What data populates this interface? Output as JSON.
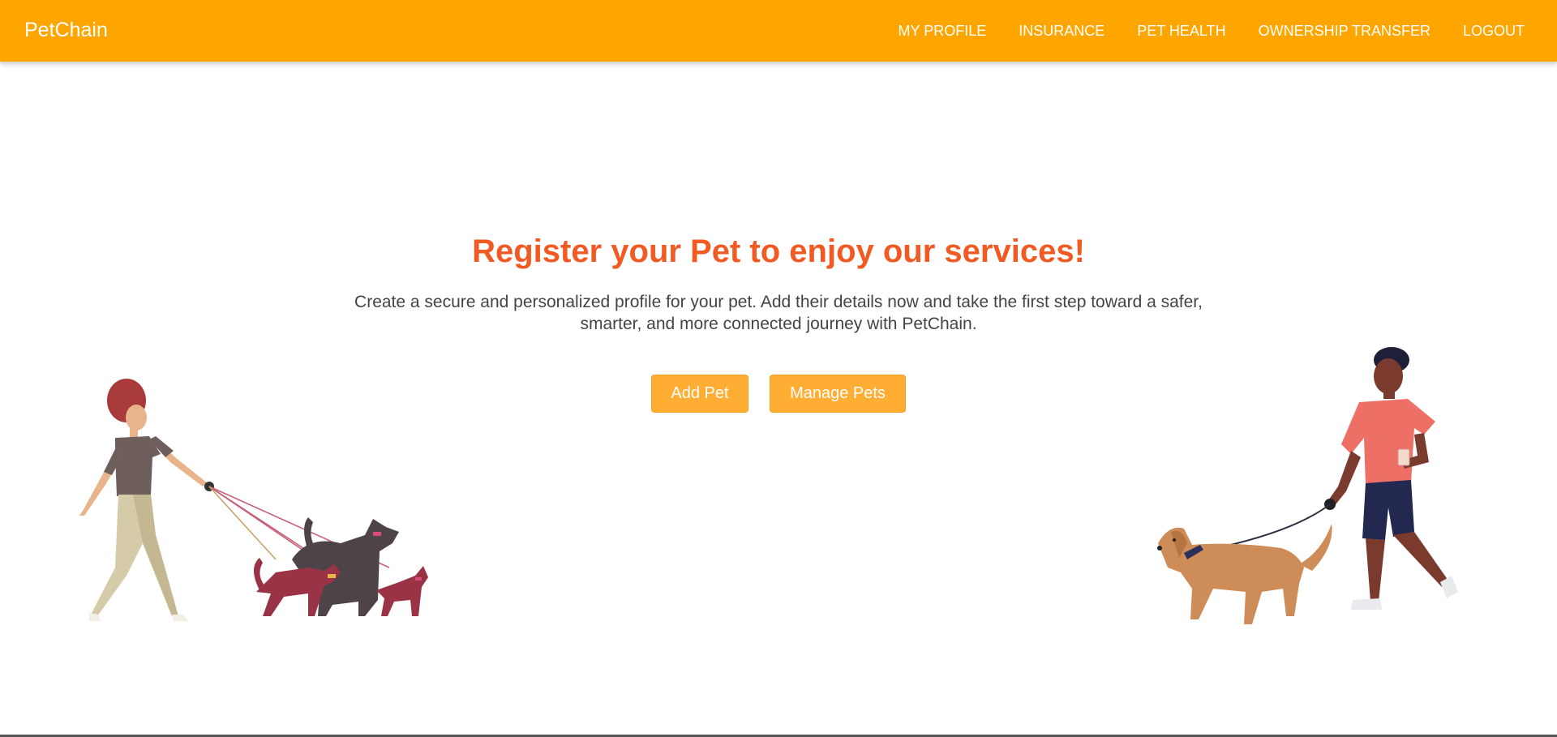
{
  "app": {
    "brand": "PetChain"
  },
  "nav": {
    "items": [
      {
        "label": "MY PROFILE"
      },
      {
        "label": "INSURANCE"
      },
      {
        "label": "PET HEALTH"
      },
      {
        "label": "OWNERSHIP TRANSFER"
      },
      {
        "label": "LOGOUT"
      }
    ]
  },
  "hero": {
    "title": "Register your Pet to enjoy our services!",
    "subtitle": "Create a secure and personalized profile for your pet. Add their details now and take the first step toward a safer, smarter, and more connected journey with PetChain."
  },
  "actions": {
    "add_pet": "Add Pet",
    "manage_pets": "Manage Pets"
  },
  "colors": {
    "navbar": "#FFA500",
    "title": "#F25A24",
    "button": "#FFAD33"
  },
  "illustrations": {
    "left": "woman-walking-three-dogs-illustration",
    "right": "man-walking-golden-dog-illustration"
  }
}
